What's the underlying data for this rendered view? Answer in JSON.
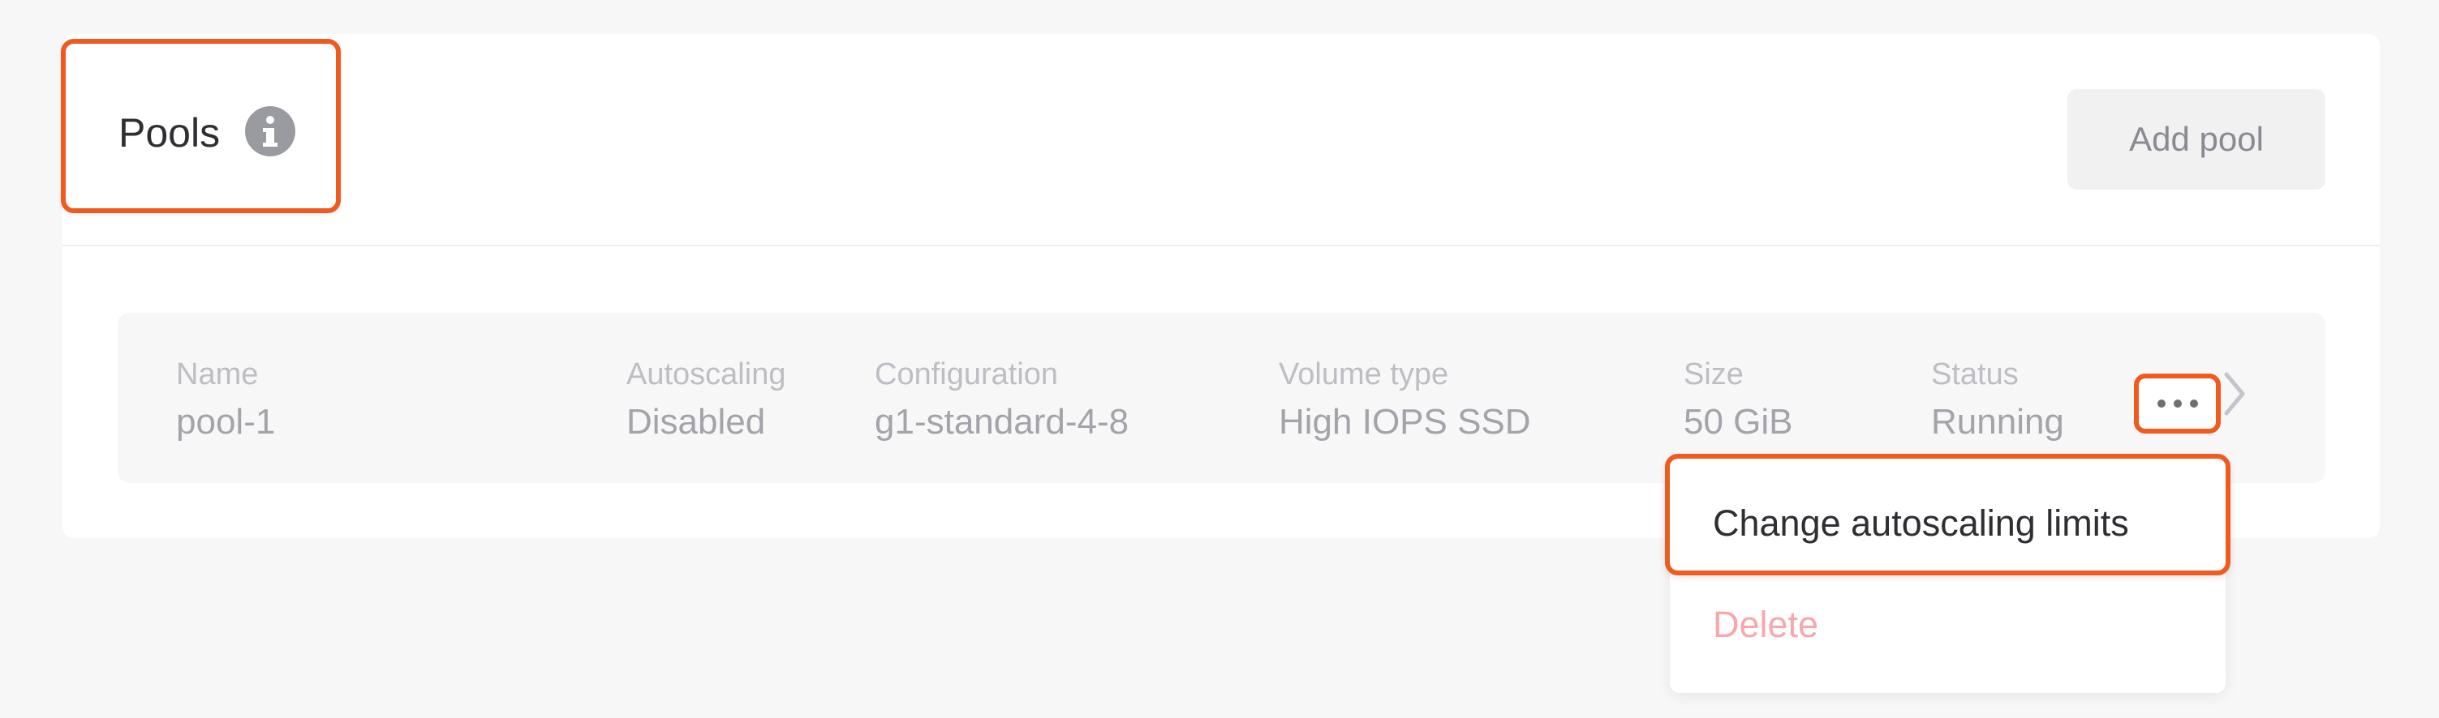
{
  "header": {
    "title": "Pools",
    "add_button_label": "Add pool"
  },
  "pool_table": {
    "columns": [
      "Name",
      "Autoscaling",
      "Configuration",
      "Volume type",
      "Size",
      "Status"
    ],
    "rows": [
      {
        "name": "pool-1",
        "autoscaling": "Disabled",
        "configuration": "g1-standard-4-8",
        "volume_type": "High IOPS SSD",
        "size": "50 GiB",
        "status": "Running"
      }
    ]
  },
  "row_menu": {
    "items": [
      {
        "label": "Change autoscaling limits"
      },
      {
        "label": "Delete"
      }
    ]
  },
  "icons": {
    "title_info": "info-icon",
    "row_menu": "more-dots-icon",
    "row_expand": "chevron-right-icon"
  },
  "colors": {
    "highlight": "#f15a1e",
    "delete_text": "#f7a8ac",
    "page_background": "#f7f7f8"
  }
}
